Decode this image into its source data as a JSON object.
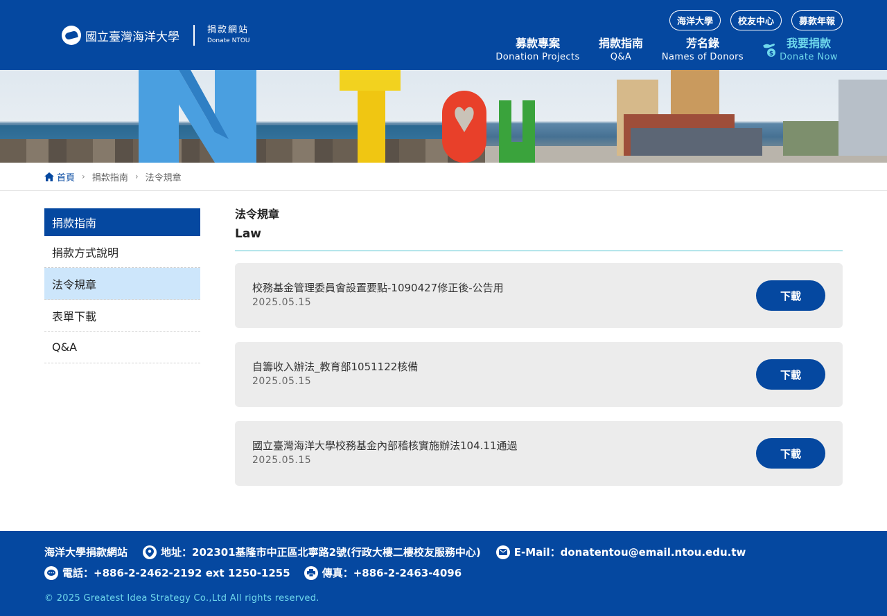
{
  "header": {
    "logo": {
      "school": "國立臺灣海洋大學",
      "site_zh": "捐款網站",
      "site_en": "Donate NTOU"
    },
    "top_links": [
      "海洋大學",
      "校友中心",
      "募款年報"
    ],
    "nav": [
      {
        "zh": "募款專案",
        "en": "Donation Projects"
      },
      {
        "zh": "捐款指南",
        "en": "Q&A"
      },
      {
        "zh": "芳名錄",
        "en": "Names of Donors"
      },
      {
        "zh": "我要捐款",
        "en": "Donate Now"
      }
    ]
  },
  "breadcrumb": {
    "home": "首頁",
    "level1": "捐款指南",
    "level2": "法令規章"
  },
  "sidebar": {
    "heading": "捐款指南",
    "items": [
      "捐款方式說明",
      "法令規章",
      "表單下載",
      "Q&A"
    ],
    "active_index": 1
  },
  "main": {
    "title_zh": "法令規章",
    "title_en": "Law",
    "download_label": "下載",
    "documents": [
      {
        "title": "校務基金管理委員會設置要點-1090427修正後-公告用",
        "date": "2025.05.15"
      },
      {
        "title": "自籌收入辦法_教育部1051122核備",
        "date": "2025.05.15"
      },
      {
        "title": "國立臺灣海洋大學校務基金內部稽核實施辦法104.11通過",
        "date": "2025.05.15"
      }
    ]
  },
  "footer": {
    "site_name": "海洋大學捐款網站",
    "address": "地址：202301基隆市中正區北寧路2號(行政大樓二樓校友服務中心)",
    "email": "E-Mail：donatentou@email.ntou.edu.tw",
    "phone": "電話：+886-2-2462-2192 ext 1250-1255",
    "fax": "傳真：+886-2-2463-4096",
    "copyright": "© 2025 Greatest Idea Strategy Co.,Ltd All rights reserved."
  },
  "colors": {
    "brand": "#0548a0",
    "accent": "#6fd8ec",
    "active": "#cde6fb",
    "rule": "#4ec2cf"
  },
  "icons": [
    "home-icon",
    "chevron-right-icon",
    "donate-hand-icon",
    "location-icon",
    "mail-icon",
    "chat-icon",
    "fax-icon"
  ]
}
